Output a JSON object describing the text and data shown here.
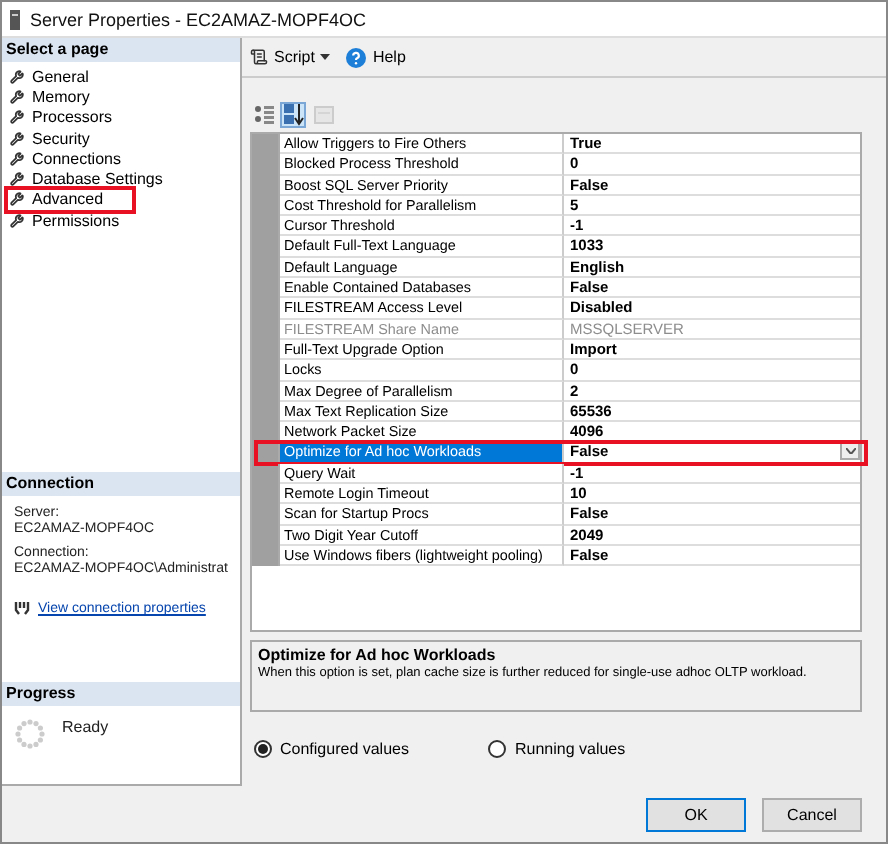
{
  "window": {
    "title": "Server Properties - EC2AMAZ-MOPF4OC"
  },
  "sidebar": {
    "heading": "Select a page",
    "items": [
      {
        "label": "General",
        "highlighted": false
      },
      {
        "label": "Memory",
        "highlighted": false
      },
      {
        "label": "Processors",
        "highlighted": false
      },
      {
        "label": "Security",
        "highlighted": false
      },
      {
        "label": "Connections",
        "highlighted": false
      },
      {
        "label": "Database Settings",
        "highlighted": false
      },
      {
        "label": "Advanced",
        "highlighted": true
      },
      {
        "label": "Permissions",
        "highlighted": false
      }
    ]
  },
  "connection": {
    "heading": "Connection",
    "server_label": "Server:",
    "server": "EC2AMAZ-MOPF4OC",
    "connection_label": "Connection:",
    "connection": "EC2AMAZ-MOPF4OC\\Administrat",
    "link": "View connection properties"
  },
  "progress": {
    "heading": "Progress",
    "status": "Ready"
  },
  "toolbar": {
    "script": "Script",
    "help": "Help"
  },
  "grid_toolbar": [
    {
      "kind": "categorized",
      "selected": false,
      "disabled": false
    },
    {
      "kind": "alphabetical",
      "selected": true,
      "disabled": false
    },
    {
      "kind": "property-pages",
      "selected": false,
      "disabled": true
    }
  ],
  "properties": [
    {
      "name": "Allow Triggers to Fire Others",
      "value": "True",
      "disabled": false,
      "selected": false,
      "highlighted": false
    },
    {
      "name": "Blocked Process Threshold",
      "value": "0",
      "disabled": false,
      "selected": false,
      "highlighted": false
    },
    {
      "name": "Boost SQL Server Priority",
      "value": "False",
      "disabled": false,
      "selected": false,
      "highlighted": false
    },
    {
      "name": "Cost Threshold for Parallelism",
      "value": "5",
      "disabled": false,
      "selected": false,
      "highlighted": false
    },
    {
      "name": "Cursor Threshold",
      "value": "-1",
      "disabled": false,
      "selected": false,
      "highlighted": false
    },
    {
      "name": "Default Full-Text Language",
      "value": "1033",
      "disabled": false,
      "selected": false,
      "highlighted": false
    },
    {
      "name": "Default Language",
      "value": "English",
      "disabled": false,
      "selected": false,
      "highlighted": false
    },
    {
      "name": "Enable Contained Databases",
      "value": "False",
      "disabled": false,
      "selected": false,
      "highlighted": false
    },
    {
      "name": "FILESTREAM Access Level",
      "value": "Disabled",
      "disabled": false,
      "selected": false,
      "highlighted": false
    },
    {
      "name": "FILESTREAM Share Name",
      "value": "MSSQLSERVER",
      "disabled": true,
      "selected": false,
      "highlighted": false
    },
    {
      "name": "Full-Text Upgrade Option",
      "value": "Import",
      "disabled": false,
      "selected": false,
      "highlighted": false
    },
    {
      "name": "Locks",
      "value": "0",
      "disabled": false,
      "selected": false,
      "highlighted": false
    },
    {
      "name": "Max Degree of Parallelism",
      "value": "2",
      "disabled": false,
      "selected": false,
      "highlighted": false
    },
    {
      "name": "Max Text Replication Size",
      "value": "65536",
      "disabled": false,
      "selected": false,
      "highlighted": false
    },
    {
      "name": "Network Packet Size",
      "value": "4096",
      "disabled": false,
      "selected": false,
      "highlighted": false
    },
    {
      "name": "Optimize for Ad hoc Workloads",
      "value": "False",
      "disabled": false,
      "selected": true,
      "highlighted": true
    },
    {
      "name": "Query Wait",
      "value": "-1",
      "disabled": false,
      "selected": false,
      "highlighted": false
    },
    {
      "name": "Remote Login Timeout",
      "value": "10",
      "disabled": false,
      "selected": false,
      "highlighted": false
    },
    {
      "name": "Scan for Startup Procs",
      "value": "False",
      "disabled": false,
      "selected": false,
      "highlighted": false
    },
    {
      "name": "Two Digit Year Cutoff",
      "value": "2049",
      "disabled": false,
      "selected": false,
      "highlighted": false
    },
    {
      "name": "Use Windows fibers (lightweight pooling)",
      "value": "False",
      "disabled": false,
      "selected": false,
      "highlighted": false
    }
  ],
  "description": {
    "title": "Optimize for Ad hoc Workloads",
    "text": "When this option is set, plan cache size is further reduced for single-use adhoc OLTP workload."
  },
  "radios": [
    {
      "label": "Configured values",
      "selected": true
    },
    {
      "label": "Running values",
      "selected": false
    }
  ],
  "buttons": [
    {
      "label": "OK",
      "default": true
    },
    {
      "label": "Cancel",
      "default": false
    }
  ]
}
